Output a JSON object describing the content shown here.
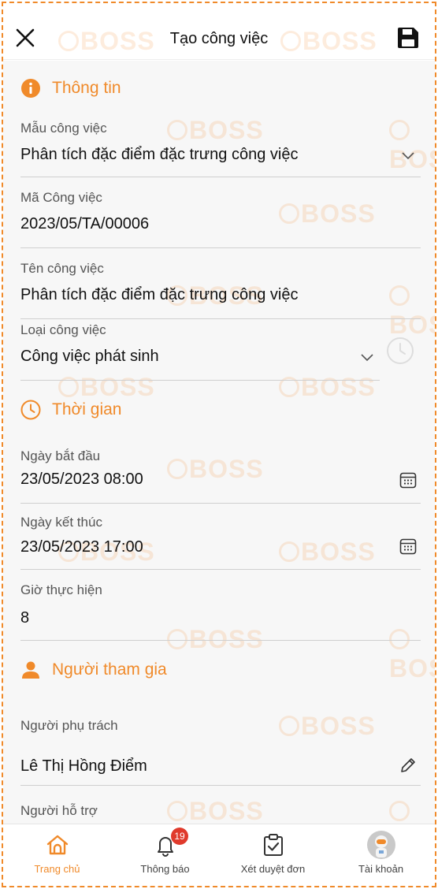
{
  "header": {
    "title": "Tạo công việc"
  },
  "watermark_text": "BOSS",
  "sections": {
    "info": {
      "label": "Thông tin"
    },
    "time": {
      "label": "Thời gian"
    },
    "people": {
      "label": "Người tham gia"
    }
  },
  "fields": {
    "template": {
      "label": "Mẫu công việc",
      "value": "Phân tích đặc điểm đặc trưng công việc"
    },
    "code": {
      "label": "Mã Công việc",
      "value": "2023/05/TA/00006"
    },
    "name": {
      "label": "Tên công việc",
      "value": "Phân tích đặc điểm đặc trưng công việc"
    },
    "type": {
      "label": "Loại công việc",
      "value": "Công việc phát sinh"
    },
    "start": {
      "label": "Ngày bắt đầu",
      "value": "23/05/2023 08:00"
    },
    "end": {
      "label": "Ngày kết thúc",
      "value": "23/05/2023 17:00"
    },
    "hours": {
      "label": "Giờ thực hiện",
      "value": "8"
    },
    "owner": {
      "label": "Người phụ trách",
      "value": "Lê Thị Hồng Điểm"
    },
    "support": {
      "label": "Người hỗ trợ"
    }
  },
  "nav": {
    "home": "Trang chủ",
    "notifications": "Thông báo",
    "notifications_badge": "19",
    "approvals": "Xét duyệt đơn",
    "account": "Tài khoản"
  },
  "colors": {
    "accent": "#f08a2a",
    "badge": "#e03a2c"
  }
}
